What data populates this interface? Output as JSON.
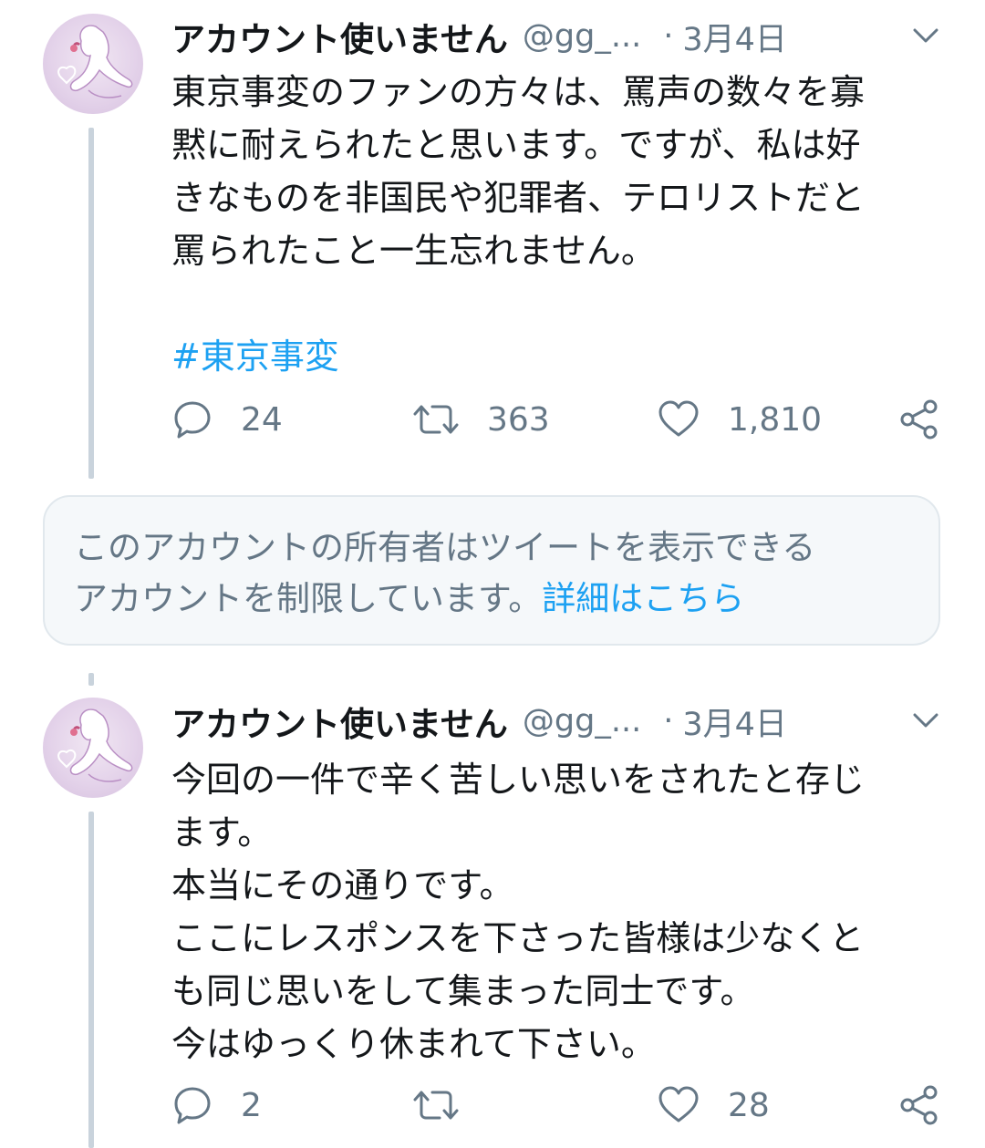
{
  "tweets": [
    {
      "display_name": "アカウント使いません",
      "handle": "@gg_...",
      "separator": "·",
      "date": "3月4日",
      "avatar_icon": "avatar-illustration-icon",
      "body_lines": [
        "東京事変のファンの方々は、罵声の数々を寡",
        "黙に耐えられたと思います。ですが、私は好",
        "きなものを非国民や犯罪者、テロリストだと",
        "罵られたこと一生忘れません。"
      ],
      "hashtag": "#東京事変",
      "replies": "24",
      "retweets": "363",
      "likes": "1,810"
    },
    {
      "display_name": "アカウント使いません",
      "handle": "@gg_...",
      "separator": "·",
      "date": "3月4日",
      "avatar_icon": "avatar-illustration-icon",
      "body_lines": [
        "今回の一件で辛く苦しい思いをされたと存じ",
        "ます。",
        "本当にその通りです。",
        "ここにレスポンスを下さった皆様は少なくと",
        "も同じ思いをして集まった同士です。",
        "今はゆっくり休まれて下さい。"
      ],
      "replies": "2",
      "retweets": "",
      "likes": "28"
    }
  ],
  "notice": {
    "line1": "このアカウントの所有者はツイートを表示できる",
    "line2": "アカウントを制限しています。",
    "link": "詳細はこちら"
  },
  "icons": {
    "reply": "reply-icon",
    "retweet": "retweet-icon",
    "like": "heart-icon",
    "share": "share-icon",
    "menu": "chevron-down-icon"
  },
  "colors": {
    "link": "#1da1f2",
    "secondary_text": "#657786",
    "thread_line": "#c9d3dc",
    "notice_bg": "#f5f8fa"
  }
}
